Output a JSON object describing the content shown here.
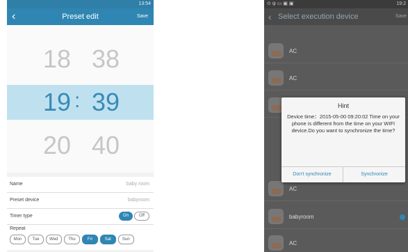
{
  "left": {
    "status_time": "13:54",
    "header": {
      "back": "‹",
      "title": "Preset edit",
      "save": "Save"
    },
    "picker": {
      "above": {
        "h": "18",
        "m": "38"
      },
      "selected": {
        "h": "19",
        "m": "39"
      },
      "below": {
        "h": "20",
        "m": "40"
      },
      "colon": ":"
    },
    "rows": {
      "name": {
        "label": "Name",
        "value": "baby room"
      },
      "device": {
        "label": "Preset device",
        "value": "babyroom"
      },
      "timer": {
        "label": "Timer type",
        "on": "On",
        "off": "Off"
      },
      "repeat": {
        "label": "Repeat"
      }
    },
    "days": [
      "Mon",
      "Tue",
      "Wed",
      "Thu",
      "Fri",
      "Sat",
      "Sun"
    ],
    "days_selected": [
      "Fri",
      "Sat"
    ],
    "accent": "#2f86b3"
  },
  "right": {
    "status_time": "19:2",
    "header": {
      "back": "‹",
      "title": "Select execution device",
      "save": "Save"
    },
    "devices": [
      "AC",
      "AC",
      "AC",
      "AC",
      "babyroom",
      "AC"
    ],
    "dialog": {
      "title": "Hint",
      "message": "Device time：2015-05-00 09:20:02 Time on your phone is different from the time on your WIFI device.Do you want to synchronize the time?",
      "cancel": "Don't synchronize",
      "confirm": "Synchronize"
    }
  }
}
